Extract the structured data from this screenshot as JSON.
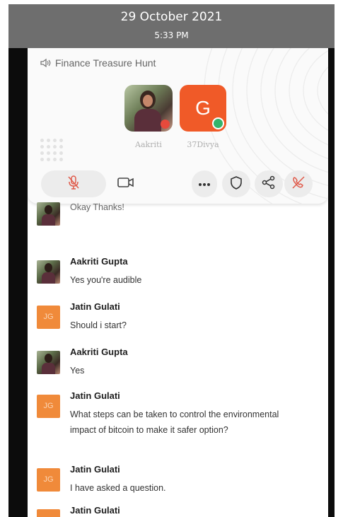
{
  "status_bar": {
    "date": "29 October 2021",
    "time": "5:33 PM"
  },
  "room": {
    "title": "Finance Treasure Hunt",
    "icon": "speaker-icon"
  },
  "participants": [
    {
      "name": "Aakriti",
      "avatar": "photo",
      "status": "muted"
    },
    {
      "name": "37Divya",
      "initial": "G",
      "avatar_color": "#f05a28",
      "status": "active"
    }
  ],
  "controls": [
    {
      "name": "mic-muted-icon",
      "color": "#e05a4a"
    },
    {
      "name": "video-camera-icon"
    },
    {
      "name": "more-icon"
    },
    {
      "name": "shield-icon"
    },
    {
      "name": "share-icon"
    },
    {
      "name": "end-call-icon",
      "color": "#e05a4a"
    }
  ],
  "chat": {
    "partial_message": "Okay Thanks!",
    "messages": [
      {
        "author": "Aakriti Gupta",
        "avatar": "photo",
        "text": "Yes you're audible"
      },
      {
        "author": "Jatin Gulati",
        "avatar_initials": "JG",
        "text": "Should i start?"
      },
      {
        "author": "Aakriti Gupta",
        "avatar": "photo",
        "text": "Yes"
      },
      {
        "author": "Jatin Gulati",
        "avatar_initials": "JG",
        "text": "What steps can be taken to control the environmental impact of bitcoin to make it safer option?"
      },
      {
        "author": "Jatin Gulati",
        "avatar_initials": "JG",
        "text": "I have asked a question."
      },
      {
        "author": "Jatin Gulati",
        "avatar_initials": "JG",
        "text": ""
      }
    ]
  },
  "colors": {
    "accent": "#f05a28",
    "jg_avatar": "#f08a3a",
    "danger": "#e05a4a"
  }
}
